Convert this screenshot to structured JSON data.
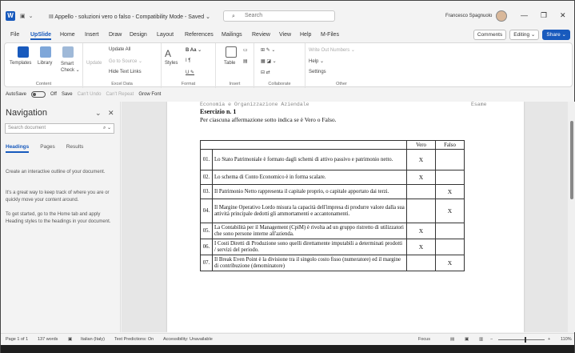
{
  "titlebar": {
    "doc_title": "III Appello - soluzioni vero o falso  -  Compatibility Mode  -  Saved  ⌄",
    "search_placeholder": "Search",
    "user_name": "Francesco Spagnuolo",
    "minimize": "—",
    "restore": "❐",
    "close": "✕"
  },
  "menu": {
    "tabs": [
      "File",
      "UpSlide",
      "Home",
      "Insert",
      "Draw",
      "Design",
      "Layout",
      "References",
      "Mailings",
      "Review",
      "View",
      "Help",
      "M-Files"
    ],
    "active": "UpSlide",
    "comments": "Comments",
    "editing": "Editing ⌄",
    "share": "Share ⌄"
  },
  "ribbon": {
    "content_group": {
      "label": "Content",
      "templates": "Templates",
      "library": "Library",
      "smart_check": "Smart Check ⌄"
    },
    "excel_group": {
      "label": "Excel Data",
      "update": "Update",
      "update_all": "Update All",
      "go_to_source": "Go to Source ⌄",
      "hide_text_links": "Hide Text Links"
    },
    "format_group": {
      "label": "Format",
      "styles": "Styles"
    },
    "insert_group": {
      "label": "Insert",
      "table": "Table"
    },
    "collaborate_group": {
      "label": "Collaborate"
    },
    "other_group": {
      "label": "Other",
      "write_out_numbers": "Write Out Numbers ⌄",
      "help": "Help ⌄",
      "settings": "Settings"
    }
  },
  "qat": {
    "autosave": "AutoSave",
    "autosave_state": "Off",
    "save": "Save",
    "undo": "Can't Undo",
    "repeat": "Can't Repeat",
    "grow_font": "Grow Font"
  },
  "nav": {
    "title": "Navigation",
    "search_placeholder": "Search document",
    "tabs": [
      "Headings",
      "Pages",
      "Results"
    ],
    "active_tab": "Headings",
    "text1": "Create an interactive outline of your document.",
    "text2": "It's a great way to keep track of where you are or quickly move your content around.",
    "text3": "To get started, go to the Home tab and apply Heading styles to the headings in your document."
  },
  "document": {
    "header_left": "Economia e Organizzazione Aziendale",
    "header_right": "Esame",
    "exercise_title": "Esercizio n. 1",
    "instructions": "Per ciascuna affermazione sotto indica se è Vero o Falso.",
    "col_vero": "Vero",
    "col_falso": "Falso",
    "rows": [
      {
        "num": "01.",
        "text": "Lo Stato Patrimoniale è formato dagli schemi di attivo passivo e patrimonio netto.",
        "vero": "X",
        "falso": ""
      },
      {
        "num": "02.",
        "text": "Lo schema di Conto Economico è in forma scalare.",
        "vero": "X",
        "falso": ""
      },
      {
        "num": "03.",
        "text": "Il Patrimonio Netto rappresenta il capitale proprio, o capitale apportato dai terzi.",
        "vero": "",
        "falso": "X"
      },
      {
        "num": "04.",
        "text": "Il Margine Operativo Lordo misura la capacità dell'impresa di produrre valore dalla sua attività principale dedotti gli ammortamenti e accantonamenti.",
        "vero": "",
        "falso": "X"
      },
      {
        "num": "05.",
        "text": "La Contabilità per il Management (CpiM) è rivolta ad un gruppo ristretto di utilizzatori che sono persone interne all'azienda.",
        "vero": "X",
        "falso": ""
      },
      {
        "num": "06.",
        "text": "I Costi Diretti di Produzione sono quelli direttamente imputabili a determinati prodotti / servizi del periodo.",
        "vero": "X",
        "falso": ""
      },
      {
        "num": "07.",
        "text": "Il Break Even Point è la divisione tra il singolo costo fisso (numeratore) ed il margine di contribuzione (denominatore)",
        "vero": "",
        "falso": "X"
      }
    ]
  },
  "status": {
    "page": "Page 1 of 1",
    "words": "137 words",
    "language": "Italian (Italy)",
    "text_predictions": "Text Predictions: On",
    "accessibility": "Accessibility: Unavailable",
    "focus": "Focus",
    "zoom": "110%"
  }
}
